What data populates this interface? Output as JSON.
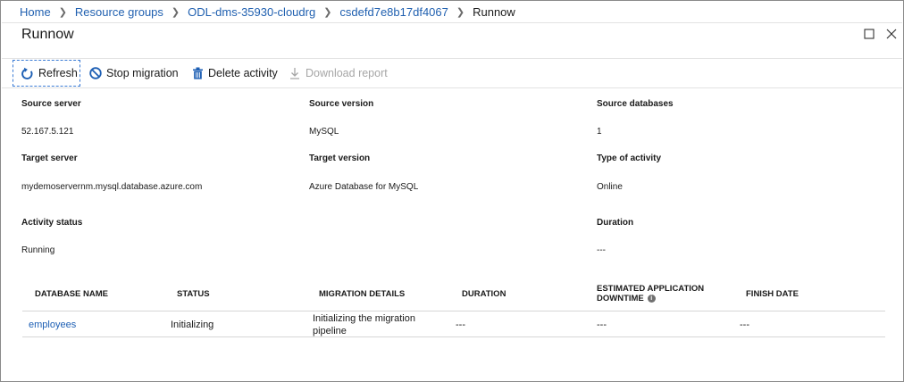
{
  "breadcrumb": {
    "items": [
      "Home",
      "Resource groups",
      "ODL-dms-35930-cloudrg",
      "csdefd7e8b17df4067"
    ],
    "current": "Runnow"
  },
  "page": {
    "title": "Runnow"
  },
  "toolbar": {
    "refresh": "Refresh",
    "stop": "Stop migration",
    "delete": "Delete activity",
    "download": "Download report"
  },
  "properties": {
    "source_server": {
      "label": "Source server",
      "value": "52.167.5.121"
    },
    "source_version": {
      "label": "Source version",
      "value": "MySQL"
    },
    "source_databases": {
      "label": "Source databases",
      "value": "1"
    },
    "target_server": {
      "label": "Target server",
      "value": "mydemoservernm.mysql.database.azure.com"
    },
    "target_version": {
      "label": "Target version",
      "value": "Azure Database for MySQL"
    },
    "type_of_activity": {
      "label": "Type of activity",
      "value": "Online"
    },
    "activity_status": {
      "label": "Activity status",
      "value": "Running"
    },
    "duration": {
      "label": "Duration",
      "value": "---"
    }
  },
  "table": {
    "columns": [
      "DATABASE NAME",
      "STATUS",
      "MIGRATION DETAILS",
      "DURATION",
      "ESTIMATED APPLICATION",
      "DOWNTIME",
      "FINISH DATE"
    ],
    "rows": [
      {
        "database": "employees",
        "status": "Initializing",
        "details": "Initializing the migration pipeline",
        "duration": "---",
        "downtime": "---",
        "finish": "---"
      }
    ]
  },
  "icons": [
    "refresh-icon",
    "stop-icon",
    "trash-icon",
    "download-icon",
    "maximize-icon",
    "close-icon",
    "info-icon"
  ],
  "colors": {
    "link": "#1d5fb4",
    "focus_border": "#3a7bd5",
    "disabled": "#a6a6a6"
  }
}
